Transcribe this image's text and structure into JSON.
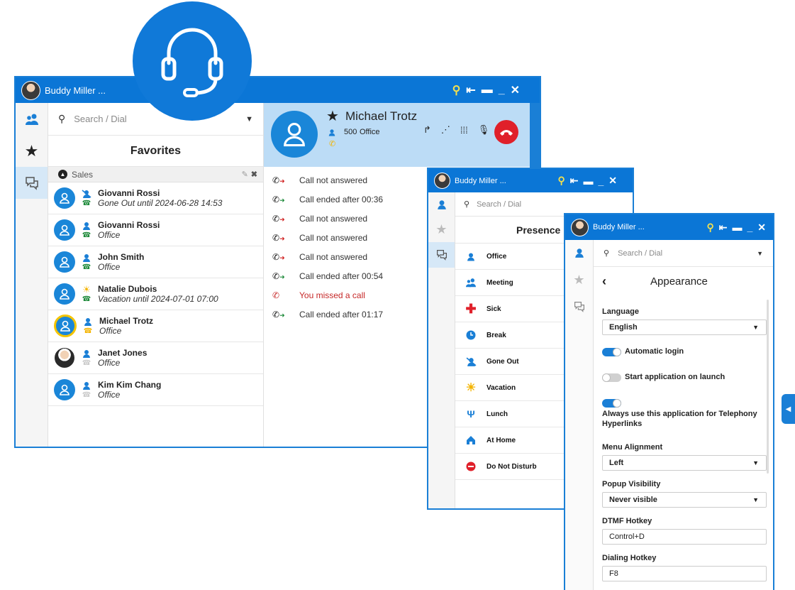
{
  "main_window": {
    "user_name": "Buddy Miller ...",
    "search": {
      "placeholder": "Search / Dial"
    },
    "favorites_title": "Favorites",
    "group_name": "Sales",
    "contacts": [
      {
        "name": "Giovanni Rossi",
        "status": "Gone Out until 2024-06-28 14:53"
      },
      {
        "name": "Giovanni Rossi",
        "status": "Office"
      },
      {
        "name": "John Smith",
        "status": "Office"
      },
      {
        "name": "Natalie Dubois",
        "status": "Vacation until 2024-07-01 07:00"
      },
      {
        "name": "Michael Trotz",
        "status": "Office"
      },
      {
        "name": "Janet Jones",
        "status": "Office"
      },
      {
        "name": "Kim Kim Chang",
        "status": "Office"
      }
    ],
    "active_call": {
      "name": "Michael Trotz",
      "extension": "500",
      "location": "Office"
    },
    "history": [
      {
        "text": "Call not answered",
        "type": "out"
      },
      {
        "text": "Call ended after 00:36",
        "type": "in"
      },
      {
        "text": "Call not answered",
        "type": "out"
      },
      {
        "text": "Call not answered",
        "type": "out"
      },
      {
        "text": "Call not answered",
        "type": "out"
      },
      {
        "text": "Call ended after 00:54",
        "type": "in"
      },
      {
        "text": "You missed a call",
        "type": "missed"
      },
      {
        "text": "Call ended after 01:17",
        "type": "in"
      }
    ]
  },
  "presence_window": {
    "user_name": "Buddy Miller ...",
    "search": {
      "placeholder": "Search / Dial"
    },
    "title": "Presence",
    "items": [
      {
        "label": "Office",
        "icon": "person-icon"
      },
      {
        "label": "Meeting",
        "icon": "meeting-icon"
      },
      {
        "label": "Sick",
        "icon": "cross-icon"
      },
      {
        "label": "Break",
        "icon": "clock-icon"
      },
      {
        "label": "Gone Out",
        "icon": "gone-out-icon"
      },
      {
        "label": "Vacation",
        "icon": "sun-icon"
      },
      {
        "label": "Lunch",
        "icon": "cutlery-icon"
      },
      {
        "label": "At Home",
        "icon": "home-icon"
      },
      {
        "label": "Do Not Disturb",
        "icon": "do-not-disturb-icon"
      }
    ]
  },
  "appearance_window": {
    "user_name": "Buddy Miller ...",
    "search": {
      "placeholder": "Search / Dial"
    },
    "title": "Appearance",
    "language": {
      "label": "Language",
      "value": "English"
    },
    "automatic_login": {
      "label": "Automatic login",
      "on": true
    },
    "start_on_launch": {
      "label": "Start application on launch",
      "on": false
    },
    "telephony_hyperlinks": {
      "label_line1": "Always use this application for Telephony",
      "label_line2": "Hyperlinks",
      "on": true
    },
    "menu_alignment": {
      "label": "Menu Alignment",
      "value": "Left"
    },
    "popup_visibility": {
      "label": "Popup Visibility",
      "value": "Never visible"
    },
    "dtmf_hotkey": {
      "label": "DTMF Hotkey",
      "value": "Control+D"
    },
    "dialing_hotkey": {
      "label": "Dialing Hotkey",
      "value": "F8"
    }
  },
  "colors": {
    "brand_blue": "#0b76d6",
    "call_header_bg": "#bcdcf6",
    "hangup_red": "#e0202a",
    "missed_red": "#c62828",
    "status_green": "#1e8a3a",
    "status_yellow": "#f4b400"
  }
}
